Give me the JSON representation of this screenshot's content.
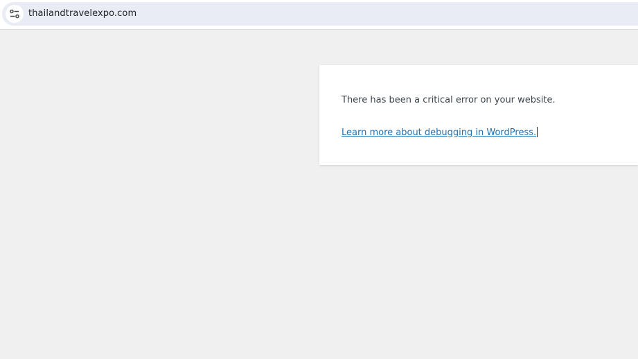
{
  "browser": {
    "url": "thailandtravelexpo.com",
    "site_info_icon": "tune-icon"
  },
  "error_page": {
    "message": "There has been a critical error on your website.",
    "link_text": "Learn more about debugging in WordPress."
  },
  "colors": {
    "page_background": "#f0f0f1",
    "card_background": "#ffffff",
    "link": "#2271b1",
    "text": "#3c434a",
    "address_bar": "#e9ecf5"
  }
}
